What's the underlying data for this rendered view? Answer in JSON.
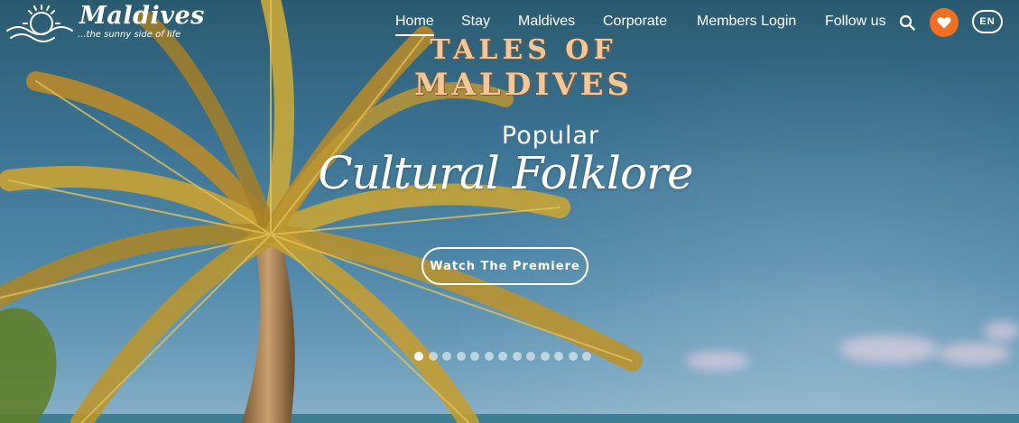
{
  "brand": {
    "name": "Maldives",
    "tagline": "...the sunny side of life"
  },
  "nav": {
    "items": [
      {
        "label": "Home",
        "active": true
      },
      {
        "label": "Stay",
        "active": false
      },
      {
        "label": "Maldives",
        "active": false
      },
      {
        "label": "Corporate",
        "active": false
      },
      {
        "label": "Members Login",
        "active": false
      },
      {
        "label": "Follow us",
        "active": false
      }
    ],
    "search_icon": "search-icon",
    "favorites_icon": "heart-icon",
    "language": "EN"
  },
  "hero": {
    "title_line1": "TALES OF",
    "title_line2": "MALDIVES",
    "subtitle": "Popular",
    "headline": "Cultural Folklore",
    "cta_label": "Watch The Premiere"
  },
  "carousel": {
    "slide_count": 13,
    "active_index": 0
  },
  "colors": {
    "accent": "#f26f21",
    "title_gold": "#f3c79a",
    "text": "#ffffff"
  }
}
